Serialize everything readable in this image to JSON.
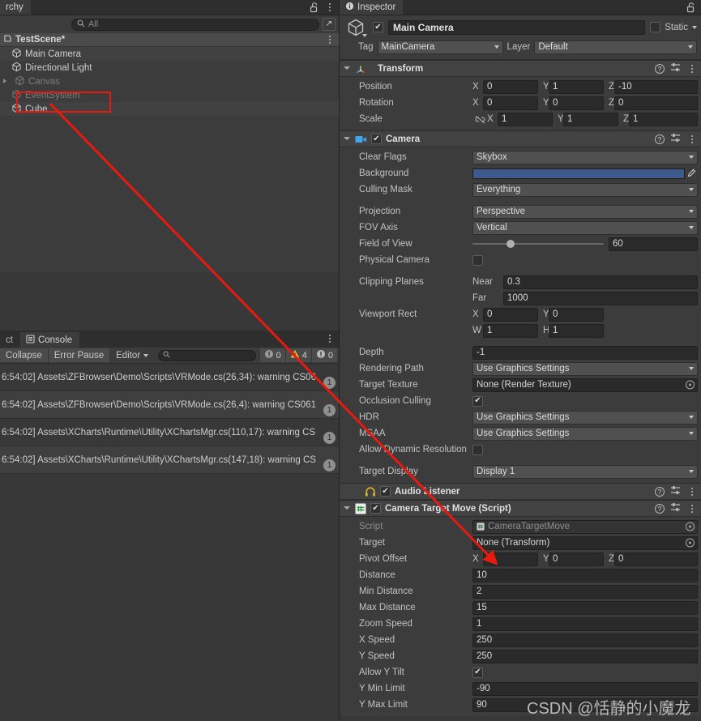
{
  "hierarchy": {
    "tab_label": "rchy",
    "lock_icon": "lock-open-icon",
    "menu_icon": "kebab-menu-icon",
    "search": {
      "placeholder": "All",
      "value": "",
      "icon": "search-icon"
    },
    "expand_icon": "expand-window-icon",
    "scene_name": "TestScene*",
    "objects": [
      {
        "name": "Main Camera",
        "icon": "gameobject-cube-icon",
        "dim": false,
        "selected": true,
        "expandable": false
      },
      {
        "name": "Directional Light",
        "icon": "gameobject-cube-icon",
        "dim": false,
        "selected": false,
        "expandable": false
      },
      {
        "name": "Canvas",
        "icon": "gameobject-cube-icon",
        "dim": true,
        "selected": false,
        "expandable": true
      },
      {
        "name": "EventSystem",
        "icon": "gameobject-cube-icon",
        "dim": true,
        "selected": false,
        "expandable": false
      },
      {
        "name": "Cube",
        "icon": "gameobject-cube-icon",
        "dim": false,
        "selected": true,
        "expandable": false
      }
    ]
  },
  "console": {
    "tabs": [
      {
        "label": "ct",
        "active": false,
        "icon": ""
      },
      {
        "label": "Console",
        "active": true,
        "icon": "console-icon"
      }
    ],
    "menu_icon": "kebab-menu-icon",
    "toolbar": {
      "clear_label": "Collapse",
      "error_pause_label": "Error Pause",
      "editor_label": "Editor",
      "search": {
        "placeholder": "",
        "value": "",
        "icon": "search-icon"
      },
      "counts": [
        {
          "icon": "log-icon",
          "value": "0"
        },
        {
          "icon": "warning-icon",
          "value": "4"
        },
        {
          "icon": "error-icon",
          "value": "0"
        }
      ]
    },
    "logs": [
      {
        "text": "6:54:02] Assets\\ZFBrowser\\Demo\\Scripts\\VRMode.cs(26,34): warning CS06",
        "badge": "1"
      },
      {
        "text": "6:54:02] Assets\\ZFBrowser\\Demo\\Scripts\\VRMode.cs(26,4): warning CS061",
        "badge": "1"
      },
      {
        "text": "6:54:02] Assets\\XCharts\\Runtime\\Utility\\XChartsMgr.cs(110,17): warning CS",
        "badge": "1"
      },
      {
        "text": "6:54:02] Assets\\XCharts\\Runtime\\Utility\\XChartsMgr.cs(147,18): warning CS",
        "badge": "1"
      }
    ]
  },
  "inspector": {
    "tab_label": "Inspector",
    "tab_icon": "info-icon",
    "lock_icon": "lock-open-icon",
    "header": {
      "object_icon": "gameobject-cube-icon",
      "enabled": true,
      "name": "Main Camera",
      "static_label": "Static",
      "static_checked": false,
      "tag_label": "Tag",
      "tag_value": "MainCamera",
      "layer_label": "Layer",
      "layer_value": "Default"
    },
    "components": [
      {
        "id": "transform",
        "title": "Transform",
        "icon": "transform-axis-icon",
        "has_enable_checkbox": false,
        "expanded": true,
        "rows": [
          {
            "kind": "vector3",
            "label": "Position",
            "x": "0",
            "y": "1",
            "z": "-10"
          },
          {
            "kind": "vector3",
            "label": "Rotation",
            "x": "0",
            "y": "0",
            "z": "0"
          },
          {
            "kind": "vector3",
            "label": "Scale",
            "x": "1",
            "y": "1",
            "z": "1",
            "link_icon": "broken-link-icon"
          }
        ]
      },
      {
        "id": "camera",
        "title": "Camera",
        "icon": "camera-icon",
        "has_enable_checkbox": true,
        "enabled": true,
        "expanded": true,
        "rows": [
          {
            "kind": "dropdown",
            "label": "Clear Flags",
            "value": "Skybox"
          },
          {
            "kind": "color",
            "label": "Background",
            "value": "#3D5A8A",
            "eyedropper_icon": "eyedropper-icon"
          },
          {
            "kind": "dropdown",
            "label": "Culling Mask",
            "value": "Everything"
          },
          {
            "kind": "spacer"
          },
          {
            "kind": "dropdown",
            "label": "Projection",
            "value": "Perspective"
          },
          {
            "kind": "dropdown",
            "label": "FOV Axis",
            "value": "Vertical"
          },
          {
            "kind": "slider",
            "label": "Field of View",
            "value": "60",
            "percent": 26
          },
          {
            "kind": "checkbox",
            "label": "Physical Camera",
            "checked": false
          },
          {
            "kind": "spacer"
          },
          {
            "kind": "pair",
            "label": "Clipping Planes",
            "sub_label": "Near",
            "value": "0.3"
          },
          {
            "kind": "pair",
            "label": "",
            "sub_label": "Far",
            "value": "1000"
          },
          {
            "kind": "rect",
            "label": "Viewport Rect",
            "a_label": "X",
            "a": "0",
            "b_label": "Y",
            "b": "0"
          },
          {
            "kind": "rect",
            "label": "",
            "a_label": "W",
            "a": "1",
            "b_label": "H",
            "b": "1"
          },
          {
            "kind": "spacer"
          },
          {
            "kind": "text",
            "label": "Depth",
            "value": "-1"
          },
          {
            "kind": "dropdown",
            "label": "Rendering Path",
            "value": "Use Graphics Settings"
          },
          {
            "kind": "object",
            "label": "Target Texture",
            "value": "None (Render Texture)"
          },
          {
            "kind": "checkbox",
            "label": "Occlusion Culling",
            "checked": true
          },
          {
            "kind": "dropdown",
            "label": "HDR",
            "value": "Use Graphics Settings"
          },
          {
            "kind": "dropdown",
            "label": "MSAA",
            "value": "Use Graphics Settings"
          },
          {
            "kind": "checkbox",
            "label": "Allow Dynamic Resolution",
            "checked": false
          },
          {
            "kind": "spacer"
          },
          {
            "kind": "dropdown",
            "label": "Target Display",
            "value": "Display 1"
          }
        ]
      },
      {
        "id": "audio-listener",
        "title": "Audio Listener",
        "icon": "headphones-icon",
        "has_enable_checkbox": true,
        "enabled": true,
        "expanded": false,
        "rows": []
      },
      {
        "id": "camera-target-move",
        "title": "Camera Target Move (Script)",
        "icon": "csharp-script-icon",
        "has_enable_checkbox": true,
        "enabled": true,
        "expanded": true,
        "rows": [
          {
            "kind": "object",
            "label": "Script",
            "value": "CameraTargetMove",
            "dim": true,
            "has_script_icon": true
          },
          {
            "kind": "object",
            "label": "Target",
            "value": "None (Transform)"
          },
          {
            "kind": "vector3",
            "label": "Pivot Offset",
            "x": "0",
            "y": "0",
            "z": "0"
          },
          {
            "kind": "text",
            "label": "Distance",
            "value": "10"
          },
          {
            "kind": "text",
            "label": "Min Distance",
            "value": "2"
          },
          {
            "kind": "text",
            "label": "Max Distance",
            "value": "15"
          },
          {
            "kind": "text",
            "label": "Zoom Speed",
            "value": "1"
          },
          {
            "kind": "text",
            "label": "X Speed",
            "value": "250"
          },
          {
            "kind": "text",
            "label": "Y Speed",
            "value": "250"
          },
          {
            "kind": "checkbox",
            "label": "Allow Y Tilt",
            "checked": true
          },
          {
            "kind": "text",
            "label": "Y Min Limit",
            "value": "-90"
          },
          {
            "kind": "text",
            "label": "Y Max Limit",
            "value": "90"
          }
        ]
      }
    ]
  },
  "annotation": {
    "arrow_color": "#E81A10",
    "highlight_target": "Cube",
    "arrow_points_to": "None (Transform)"
  },
  "watermark": "CSDN @恬静的小魔龙"
}
